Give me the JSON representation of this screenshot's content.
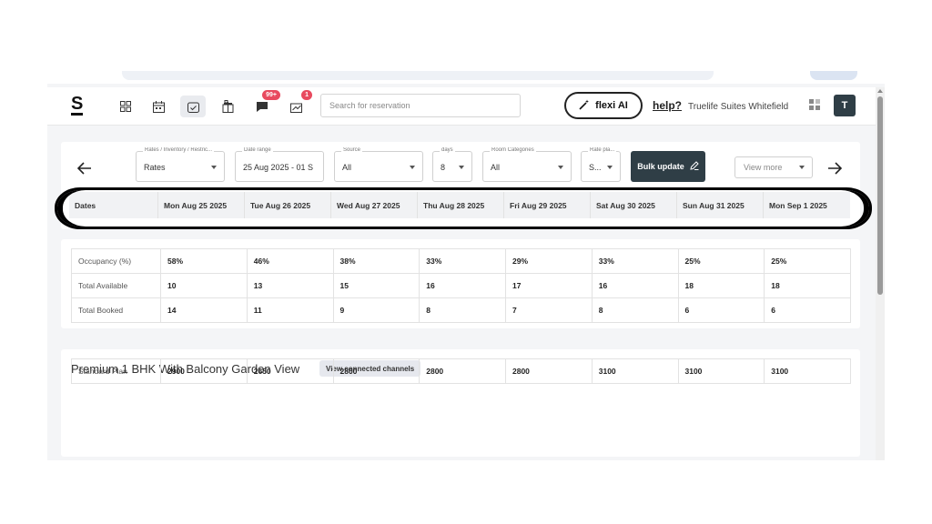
{
  "topbar": {
    "logo": "S",
    "notifications_badge": "99+",
    "analytics_badge": "1",
    "search_placeholder": "Search for reservation",
    "flexi_label": "flexi AI",
    "help_label": "help?",
    "hotel_name": "Truelife Suites Whitefield",
    "avatar_initial": "T"
  },
  "filters": {
    "rates": {
      "label": "Rates / Inventory / Restric...",
      "value": "Rates"
    },
    "date_range": {
      "label": "Date range",
      "value": "25 Aug 2025 - 01 S"
    },
    "source": {
      "label": "Source",
      "value": "All"
    },
    "days": {
      "label": "days",
      "value": "8"
    },
    "room_categories": {
      "label": "Room Categories",
      "value": "All"
    },
    "rate_plan": {
      "label": "Rate pla...",
      "value": "S..."
    },
    "bulk_update": "Bulk update",
    "view_more": "View more"
  },
  "dates": {
    "header": "Dates",
    "days": [
      "Mon Aug 25 2025",
      "Tue Aug 26 2025",
      "Wed Aug 27 2025",
      "Thu Aug 28 2025",
      "Fri Aug 29 2025",
      "Sat Aug 30 2025",
      "Sun Aug 31 2025",
      "Mon Sep 1 2025"
    ]
  },
  "stats": [
    {
      "label": "Occupancy (%)",
      "values": [
        "58%",
        "46%",
        "38%",
        "33%",
        "29%",
        "33%",
        "25%",
        "25%"
      ]
    },
    {
      "label": "Total Available",
      "values": [
        "10",
        "13",
        "15",
        "16",
        "17",
        "16",
        "18",
        "18"
      ]
    },
    {
      "label": "Total Booked",
      "values": [
        "14",
        "11",
        "9",
        "8",
        "7",
        "8",
        "6",
        "6"
      ]
    }
  ],
  "room": {
    "title": "Premium 1 BHK With Balcony Garden View",
    "channels_button": "View connected channels",
    "plans": [
      {
        "label": "Standard Plan",
        "values": [
          "2900",
          "2650",
          "2800",
          "2800",
          "2800",
          "3100",
          "3100",
          "3100"
        ]
      }
    ]
  }
}
